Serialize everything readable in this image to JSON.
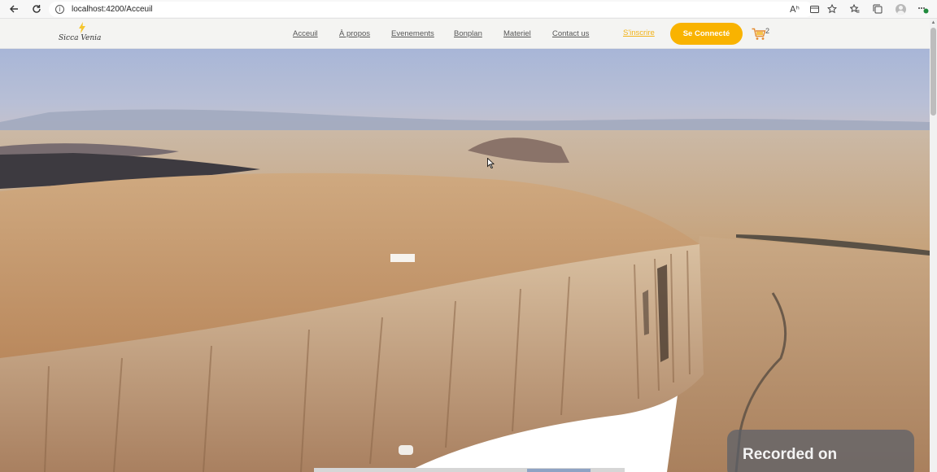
{
  "browser": {
    "url": "localhost:4200/Acceuil",
    "icons": [
      "back-arrow-icon",
      "reload-icon",
      "info-icon",
      "read-aloud-icon",
      "app-available-icon",
      "favorite-star-icon",
      "favorites-icon",
      "collections-icon",
      "profile-icon",
      "extensions-icon"
    ],
    "read_aloud_label": "Aʰ"
  },
  "navbar": {
    "logo_text": "Sicca Venia",
    "links": [
      "Acceuil",
      "À propos",
      "Evenements",
      "Bonplan",
      "Materiel",
      "Contact us"
    ],
    "signup": "S'inscrire",
    "connect": "Se Connecté",
    "cart_count": "2",
    "accent_color": "#f9b300"
  },
  "hero": {
    "image": "aerial-desert-mesa-photo"
  },
  "overlay": {
    "recorded_text": "Recorded on"
  }
}
